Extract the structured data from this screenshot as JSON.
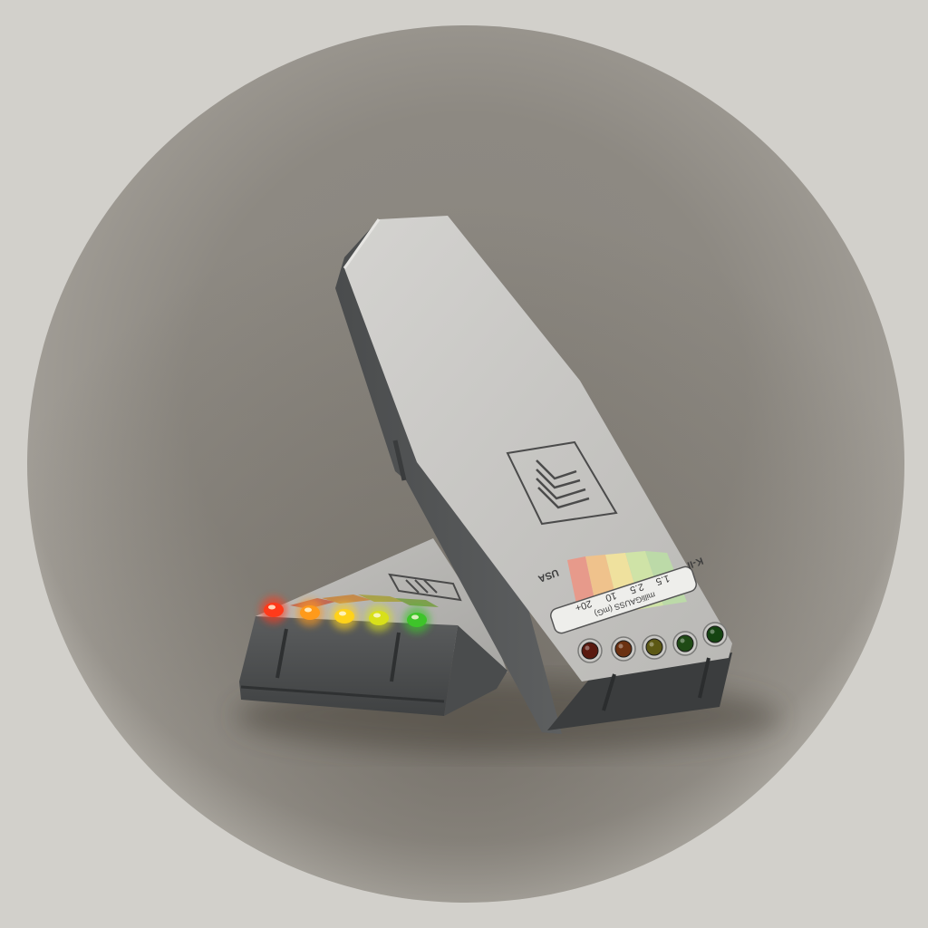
{
  "app_icon": {
    "subject": "EMF meter icon",
    "background_color": "#d2d0cb",
    "disc_color": "#8e8a83",
    "device": {
      "model_label": "K-II",
      "origin_label": "USA",
      "scale_title": "milliGAUSS (mG)",
      "scale_ticks": [
        "1.5",
        "2.5",
        "10",
        "20+"
      ],
      "leds": [
        {
          "name": "dark-red",
          "color": "#5a1a10"
        },
        {
          "name": "orange",
          "color": "#6b3112"
        },
        {
          "name": "yellow",
          "color": "#5c5814"
        },
        {
          "name": "light-green",
          "color": "#1f4a15"
        },
        {
          "name": "green",
          "color": "#154412"
        }
      ],
      "band_colors": [
        "#e79a8b",
        "#efc28c",
        "#efe19e",
        "#cfe3a7",
        "#bcdaa8"
      ]
    },
    "back_device": {
      "lit_leds": [
        {
          "name": "red",
          "color": "#ff3a1a"
        },
        {
          "name": "orange",
          "color": "#ff9a1a"
        },
        {
          "name": "yellow",
          "color": "#ffd21a"
        },
        {
          "name": "yellow-green",
          "color": "#d8e01a"
        },
        {
          "name": "green",
          "color": "#3ec42a"
        }
      ]
    }
  }
}
